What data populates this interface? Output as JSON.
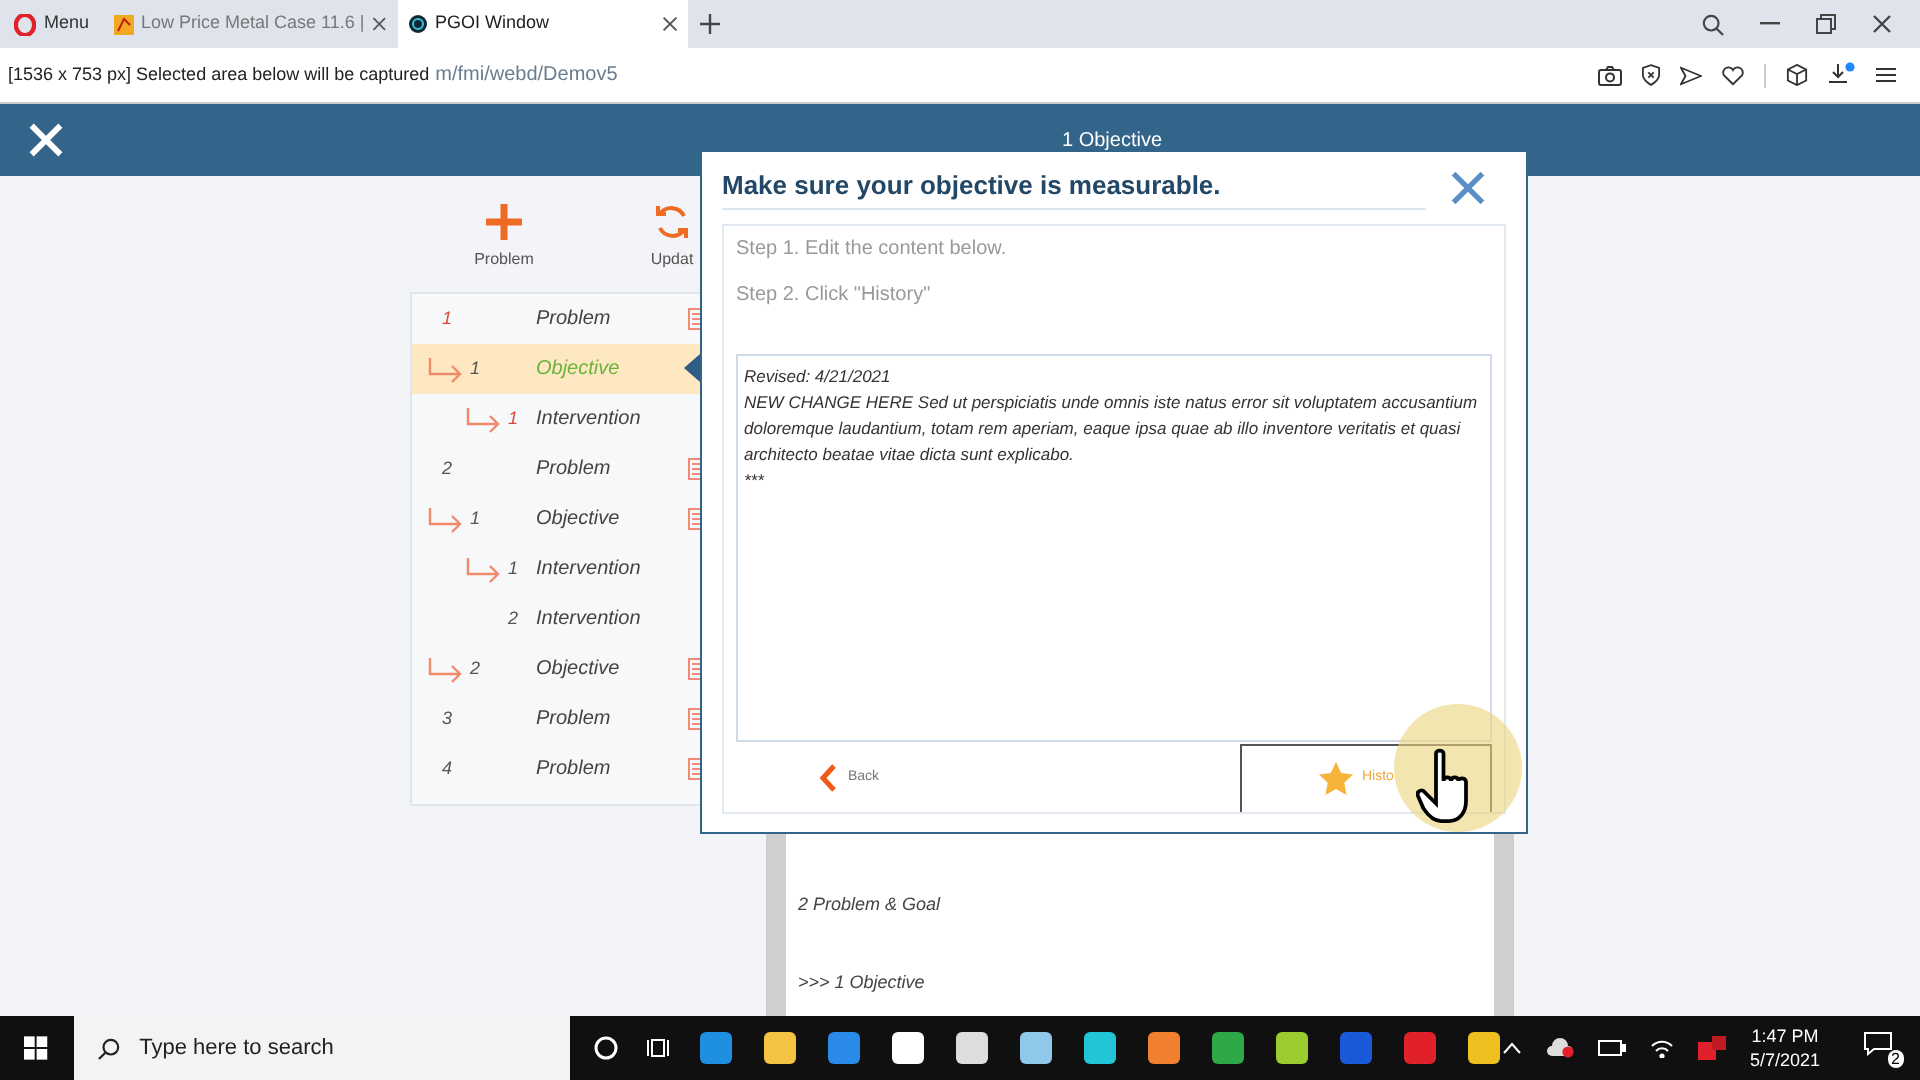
{
  "browser": {
    "menu_label": "Menu",
    "tabs": [
      {
        "title": "Low Price Metal Case 11.6 |",
        "selected": false
      },
      {
        "title": "PGOI Window",
        "selected": true
      }
    ],
    "capture_notice": "[1536 x 753 px] Selected area below will be captured",
    "url": "m/fmi/webd/Demov5"
  },
  "header": {
    "title": "1 Objective"
  },
  "toolbar": [
    {
      "label": "Problem",
      "kind": "add"
    },
    {
      "label": "Updat",
      "kind": "refresh"
    }
  ],
  "tree": [
    {
      "number": "1",
      "label": "Problem",
      "highlight": true,
      "selected": false,
      "arrow": false,
      "calendar": true,
      "children": [
        {
          "number": "1",
          "label": "Objective",
          "highlight": false,
          "selected": true,
          "arrow": true,
          "calendar": false,
          "children": [
            {
              "number": "1",
              "label": "Intervention",
              "highlight": true,
              "selected": false,
              "arrow": true,
              "calendar": false
            }
          ]
        }
      ]
    },
    {
      "number": "2",
      "label": "Problem",
      "highlight": false,
      "selected": false,
      "arrow": false,
      "calendar": true,
      "children": [
        {
          "number": "1",
          "label": "Objective",
          "highlight": false,
          "selected": false,
          "arrow": true,
          "calendar": true,
          "children": [
            {
              "number": "1",
              "label": "Intervention",
              "highlight": false,
              "selected": false,
              "arrow": true,
              "calendar": false
            },
            {
              "number": "2",
              "label": "Intervention",
              "highlight": false,
              "selected": false,
              "arrow": false,
              "calendar": false
            }
          ]
        },
        {
          "number": "2",
          "label": "Objective",
          "highlight": false,
          "selected": false,
          "arrow": true,
          "calendar": true
        }
      ]
    },
    {
      "number": "3",
      "label": "Problem",
      "highlight": false,
      "selected": false,
      "arrow": false,
      "calendar": true
    },
    {
      "number": "4",
      "label": "Problem",
      "highlight": false,
      "selected": false,
      "arrow": false,
      "calendar": true
    }
  ],
  "history_panel": {
    "lines": [
      "2 Problem & Goal",
      ">>> 1 Objective"
    ]
  },
  "dialog": {
    "title": "Make sure your objective is measurable.",
    "steps": [
      "Step 1. Edit the content below.",
      "Step 2. Click \"History\""
    ],
    "content": [
      "Revised: 4/21/2021",
      "NEW CHANGE HERE Sed ut perspiciatis unde omnis iste natus error sit voluptatem accusantium doloremque laudantium, totam rem aperiam, eaque ipsa quae ab illo inventore veritatis et quasi architecto beatae vitae dicta sunt explicabo.",
      "***"
    ],
    "back_label": "Back",
    "history_label": "Histo"
  },
  "taskbar": {
    "search_placeholder": "Type here to search",
    "time": "1:47 PM",
    "date": "5/7/2021",
    "notification_count": "2"
  }
}
